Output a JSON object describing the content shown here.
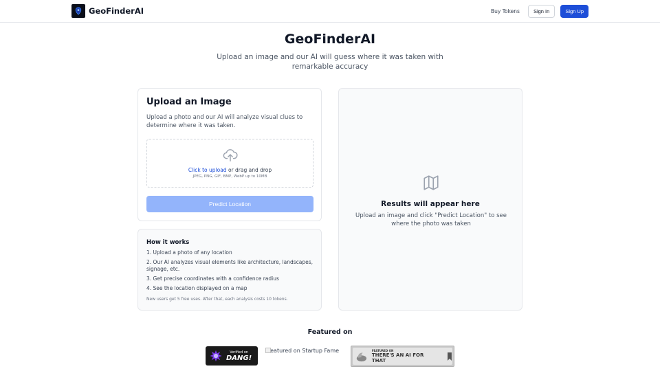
{
  "header": {
    "brand": "GeoFinderAI",
    "buy_tokens": "Buy Tokens",
    "sign_in": "Sign In",
    "sign_up": "Sign Up"
  },
  "hero": {
    "title": "GeoFinderAI",
    "subtitle": "Upload an image and our AI will guess where it was taken with remarkable accuracy"
  },
  "upload": {
    "title": "Upload an Image",
    "description": "Upload a photo and our AI will analyze visual clues to determine where it was taken.",
    "click_to_upload": "Click to upload",
    "drag_drop": " or drag and drop",
    "hint": "JPEG, PNG, GIF, BMP, WebP up to 10MB",
    "predict_button": "Predict Location"
  },
  "how_it_works": {
    "title": "How it works",
    "steps": [
      "1. Upload a photo of any location",
      "2. Our AI analyzes visual elements like architecture, landscapes, signage, etc.",
      "3. Get precise coordinates with a confidence radius",
      "4. See the location displayed on a map"
    ],
    "note": "New users get 5 free uses. After that, each analysis costs 10 tokens."
  },
  "results": {
    "title": "Results will appear here",
    "description": "Upload an image and click \"Predict Location\" to see where the photo was taken"
  },
  "featured": {
    "title": "Featured on",
    "dang_small": "Verified on",
    "dang_big": "DANG!",
    "startup_fame_alt": "Featured on Startup Fame",
    "aift_small": "FEATURED ON",
    "aift_big": "THERE'S AN AI FOR THAT"
  },
  "colors": {
    "primary": "#1d4ed8",
    "predict_disabled": "#93b4fb"
  }
}
